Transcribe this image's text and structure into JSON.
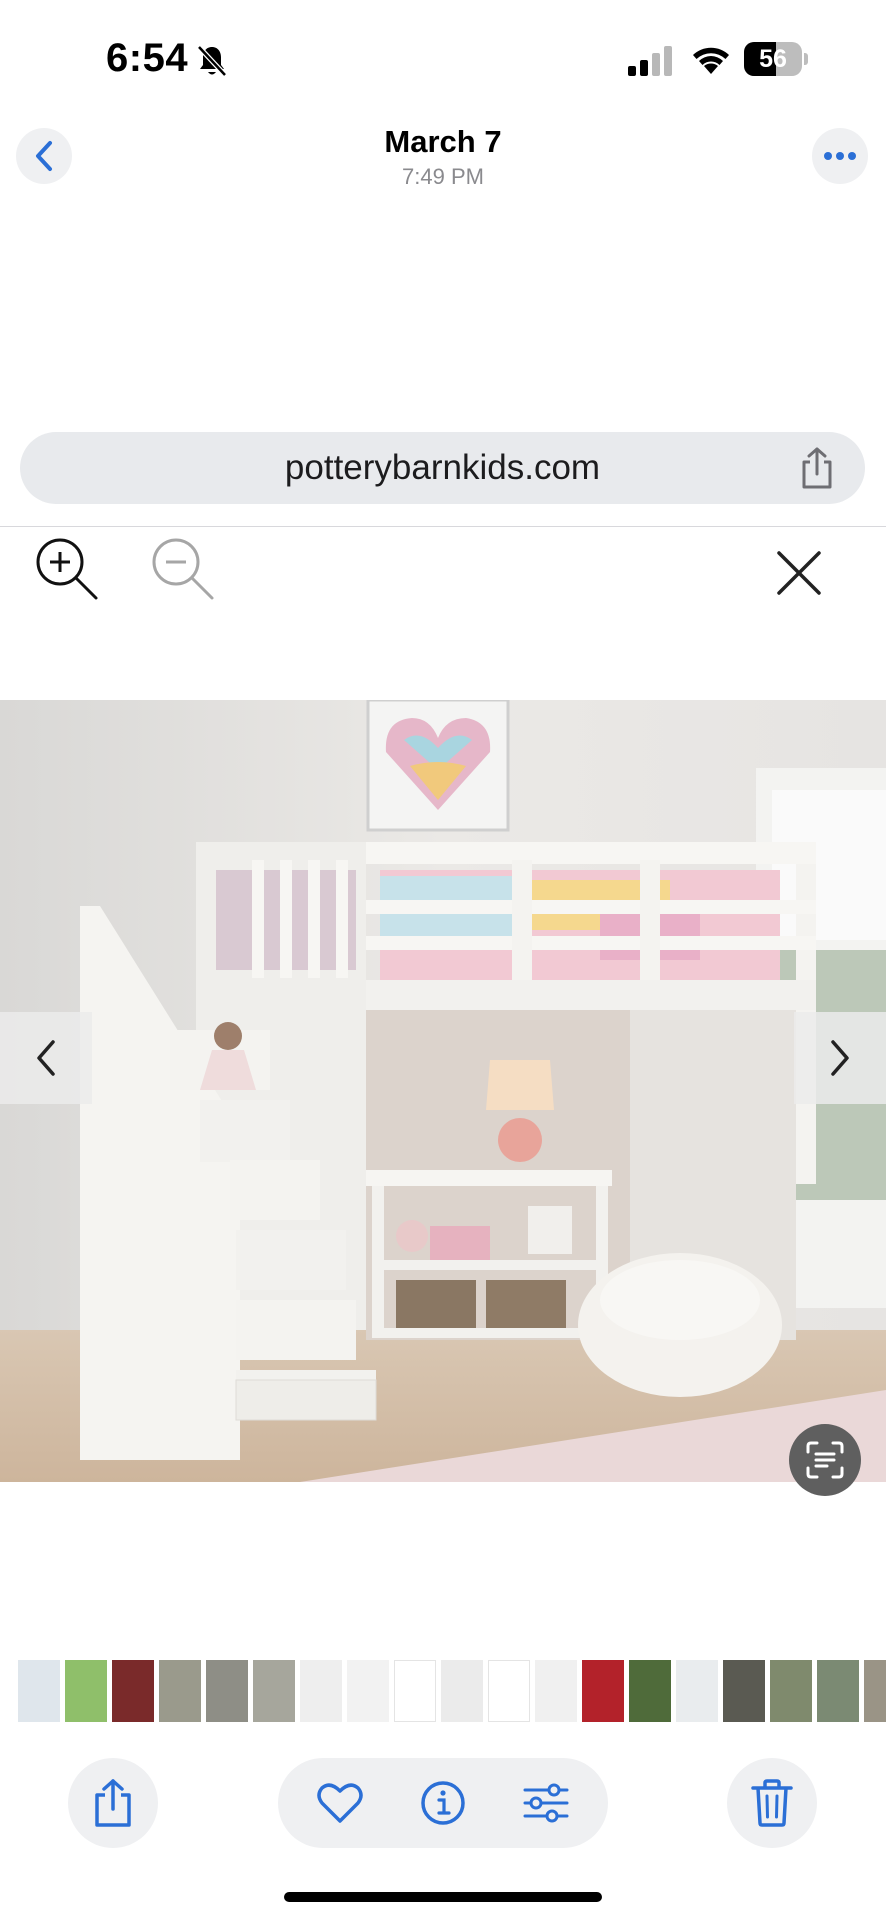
{
  "status_bar": {
    "time": "6:54",
    "battery": "56",
    "icons": [
      "bell-slash-icon",
      "signal-icon",
      "wifi-icon",
      "battery-icon"
    ]
  },
  "nav": {
    "title": "March 7",
    "subtitle": "7:49 PM",
    "back_icon": "chevron-left-icon",
    "more_icon": "ellipsis-icon"
  },
  "url_bar": {
    "domain": "potterybarnkids.com",
    "share_icon": "share-icon"
  },
  "zoom_controls": {
    "zoom_in_icon": "zoom-in-icon",
    "zoom_out_icon": "zoom-out-icon",
    "close_icon": "close-icon"
  },
  "photo": {
    "subject": "white loft bed with stairs, desk shelf and bean bag",
    "prev_icon": "chevron-left-icon",
    "next_icon": "chevron-right-icon",
    "live_text_icon": "live-text-icon"
  },
  "thumbnails": [
    {
      "color": "#dfe6ec"
    },
    {
      "color": "#8fbf6a"
    },
    {
      "color": "#7a2a2a"
    },
    {
      "color": "#9a9a8c"
    },
    {
      "color": "#8e8e86"
    },
    {
      "color": "#a6a69c"
    },
    {
      "color": "#eeeeee"
    },
    {
      "color": "#f2f2f2"
    },
    {
      "color": "#ffffff"
    },
    {
      "color": "#ebebeb"
    },
    {
      "color": "#ffffff"
    },
    {
      "color": "#f0f0f0"
    },
    {
      "color": "#b3222a"
    },
    {
      "color": "#4f6b3a"
    },
    {
      "color": "#e9ecee"
    },
    {
      "color": "#5a5a52"
    },
    {
      "color": "#7f8a6d"
    },
    {
      "color": "#7b8a73"
    },
    {
      "color": "#9a9486"
    }
  ],
  "toolbar": {
    "share_icon": "share-icon",
    "favorite_icon": "heart-icon",
    "info_icon": "info-icon",
    "adjust_icon": "sliders-icon",
    "delete_icon": "trash-icon"
  },
  "colors": {
    "accent": "#2b6fd6",
    "toolbar_bg": "#eff0f2"
  }
}
